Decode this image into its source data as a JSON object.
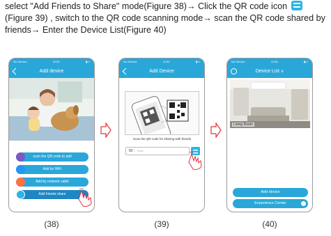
{
  "instructions": {
    "part1": "select \"Add Friends to Share\" mode(Figure 38)→ Click the QR code icon",
    "part2": "(Figure 39) , switch to the QR code scanning mode→ scan the QR code shared by friends→ Enter the Device List(Figure 40)"
  },
  "status_bar": {
    "carrier": "No Service",
    "time": "11:50"
  },
  "phone1": {
    "title": "Add device",
    "options": [
      {
        "label": "scan the QR code to add",
        "icon": "qr-scan-icon",
        "color": "#7e57c2"
      },
      {
        "label": "Add by WiFi",
        "icon": "wifi-icon",
        "color": "#2196f3"
      },
      {
        "label": "Add by network cable",
        "icon": "network-cable-icon",
        "color": "#ff7043"
      },
      {
        "label": "Add friends share",
        "icon": "friends-share-icon",
        "color": "#29b6e8"
      }
    ],
    "caption": "(38)"
  },
  "phone2": {
    "title": "Add Device",
    "scan_hint": "Scan the QR code for sharing with friends",
    "id_label": "ID :",
    "id_placeholder": "Scan",
    "caption": "(39)"
  },
  "phone3": {
    "title": "Device List",
    "room_label": "Living Room",
    "add_button": "Add device",
    "experience_button": "Experience Center",
    "caption": "(40)"
  },
  "colors": {
    "accent": "#2aa7d9",
    "arrow": "#e5303a"
  }
}
